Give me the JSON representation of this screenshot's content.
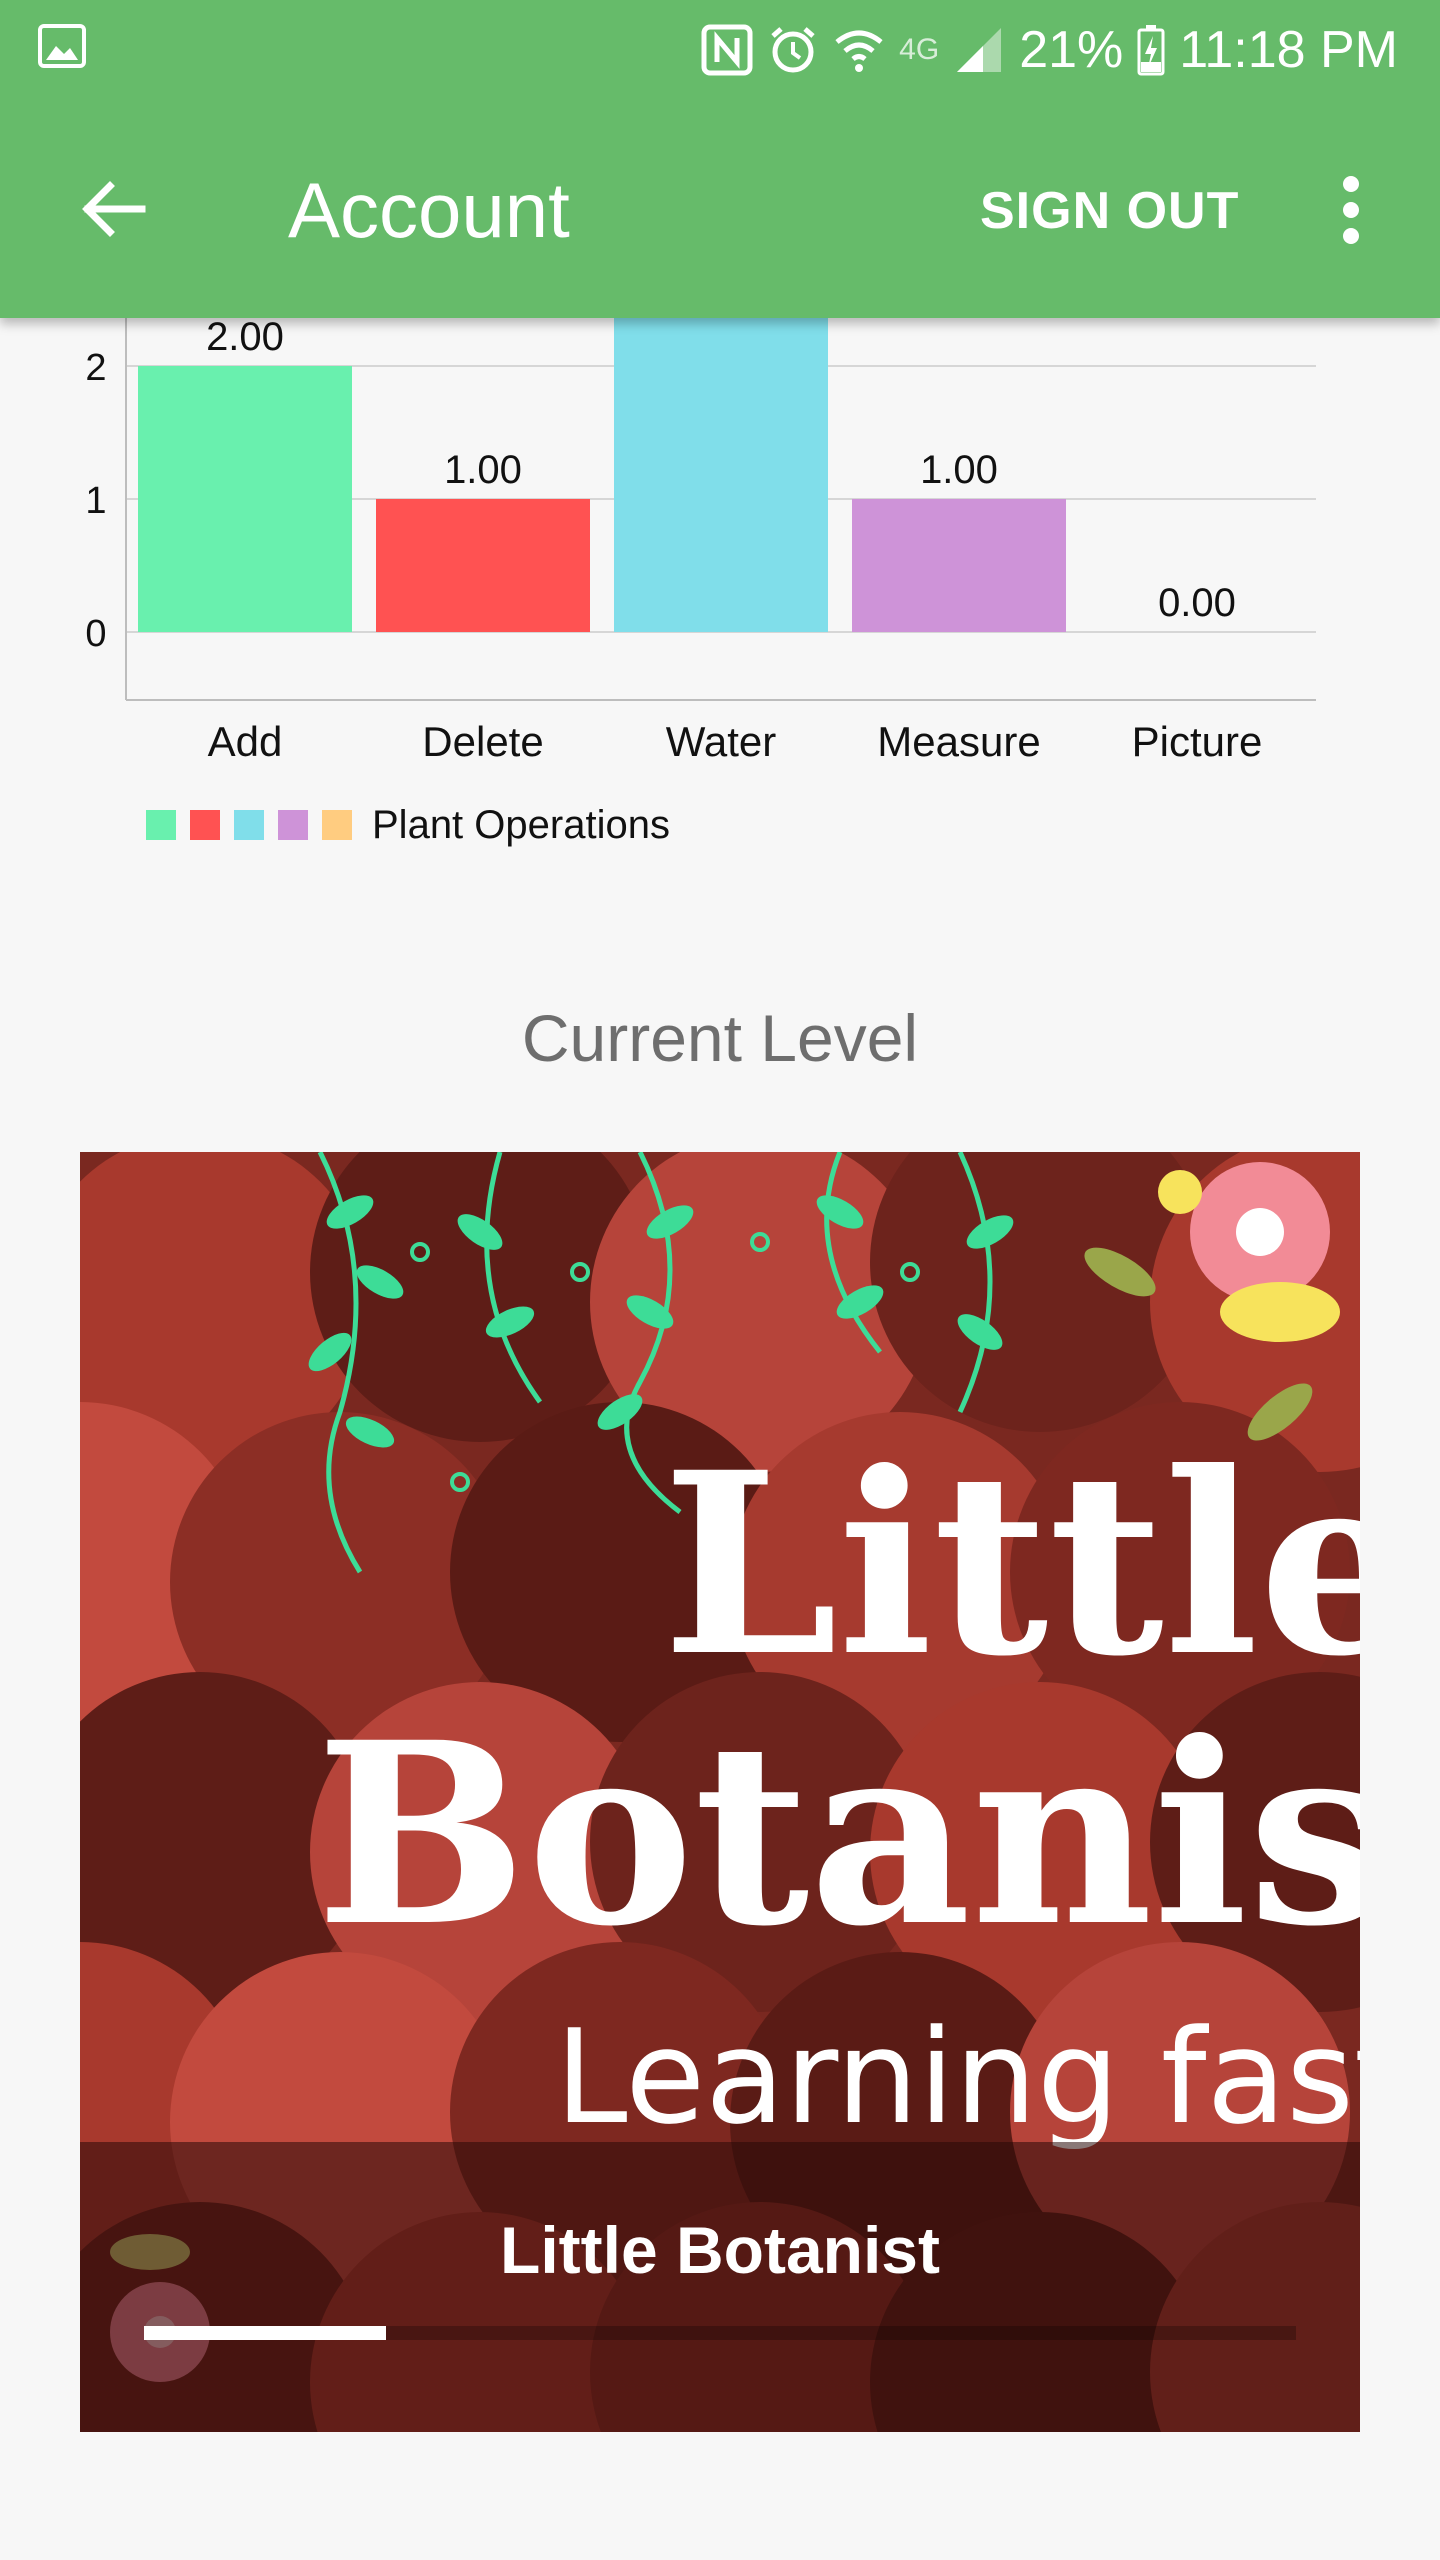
{
  "status_bar": {
    "battery": "21%",
    "time": "11:18 PM",
    "network": "4G"
  },
  "app_bar": {
    "title": "Account",
    "sign_out_label": "SIGN OUT",
    "back_icon": "arrow-back-icon",
    "overflow_icon": "more-vert-icon"
  },
  "colors": {
    "app_bar": "#66bb6a",
    "background": "#f7f7f7"
  },
  "chart_data": {
    "type": "bar",
    "categories": [
      "Add",
      "Delete",
      "Water",
      "Measure",
      "Picture"
    ],
    "values": [
      2.0,
      1.0,
      3.0,
      1.0,
      0.0
    ],
    "value_labels": [
      "2.00",
      "1.00",
      "",
      "1.00",
      "0.00"
    ],
    "colors": [
      "#69f0ae",
      "#ff5252",
      "#80deea",
      "#ce93d8",
      "#ffcc80"
    ],
    "y_ticks": [
      "0",
      "1",
      "2"
    ],
    "ylim": [
      -0.5,
      3
    ],
    "grid": true,
    "legend": {
      "label": "Plant Operations",
      "placement": "bottom-left"
    }
  },
  "level": {
    "heading": "Current Level",
    "badge_lines": [
      "Little",
      "Botanist",
      "Learning fast"
    ],
    "name": "Little Botanist",
    "progress": 0.21
  }
}
